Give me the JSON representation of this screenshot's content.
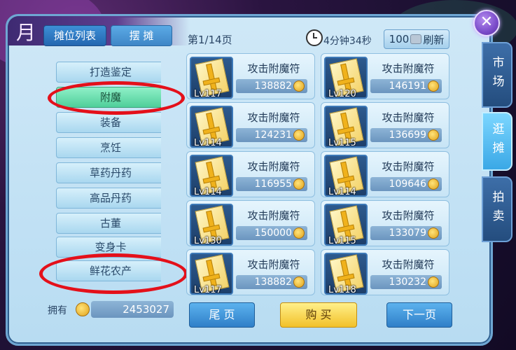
{
  "window": {
    "title": "逛摊",
    "title_deco": "月",
    "close_icon": "close-icon"
  },
  "left_tabs": [
    {
      "label": "摊位列表",
      "active": true
    },
    {
      "label": "摆 摊",
      "active": false
    }
  ],
  "categories": [
    {
      "label": "打造鉴定",
      "selected": false
    },
    {
      "label": "附魔",
      "selected": true
    },
    {
      "label": "装备",
      "selected": false
    },
    {
      "label": "烹饪",
      "selected": false
    },
    {
      "label": "草药丹药",
      "selected": false
    },
    {
      "label": "高品丹药",
      "selected": false
    },
    {
      "label": "古董",
      "selected": false
    },
    {
      "label": "变身卡",
      "selected": false
    },
    {
      "label": "鲜花农产",
      "selected": false
    }
  ],
  "wallet": {
    "label": "拥有",
    "amount": "2453027"
  },
  "header": {
    "page": "第1/14页",
    "timer": "4分钟34秒",
    "refresh_cost": "100",
    "refresh_label": "刷新"
  },
  "items": [
    {
      "name": "攻击附魔符",
      "level": "Lv117",
      "price": "138882"
    },
    {
      "name": "攻击附魔符",
      "level": "Lv120",
      "price": "146191"
    },
    {
      "name": "攻击附魔符",
      "level": "Lv114",
      "price": "124231"
    },
    {
      "name": "攻击附魔符",
      "level": "Lv115",
      "price": "136699"
    },
    {
      "name": "攻击附魔符",
      "level": "Lv114",
      "price": "116955"
    },
    {
      "name": "攻击附魔符",
      "level": "Lv114",
      "price": "109646"
    },
    {
      "name": "攻击附魔符",
      "level": "Lv130",
      "price": "150000"
    },
    {
      "name": "攻击附魔符",
      "level": "Lv115",
      "price": "133079"
    },
    {
      "name": "攻击附魔符",
      "level": "Lv117",
      "price": "138882"
    },
    {
      "name": "攻击附魔符",
      "level": "Lv118",
      "price": "130232"
    }
  ],
  "bottom": {
    "last_page": "尾 页",
    "buy": "购 买",
    "next_page": "下一页"
  },
  "side_tabs": {
    "market": "市场",
    "stall": "逛摊",
    "auction": "拍卖"
  },
  "colors": {
    "annotation_red": "#e4101a",
    "selected_green": "#4fcf9a",
    "panel_blue": "#cfe8f7"
  }
}
